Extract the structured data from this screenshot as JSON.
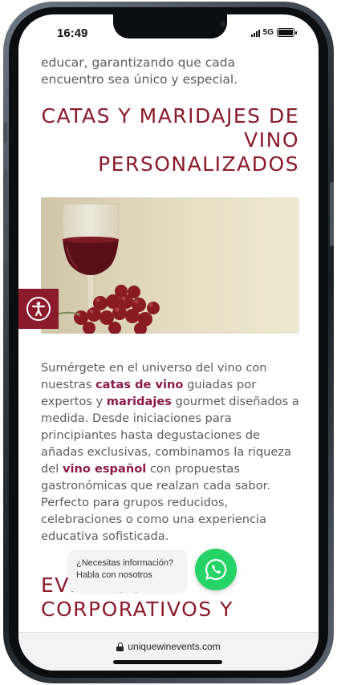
{
  "status_bar": {
    "time": "16:49",
    "network": "5G"
  },
  "article": {
    "intro_text": "educar, garantizando que cada encuentro sea único y especial.",
    "heading": "CATAS Y MARIDAJES DE VINO PERSONALIZADOS",
    "body": {
      "p1": "Sumérgete en el universo del vino con nuestras ",
      "link_catas": "catas de vino",
      "p2": " guiadas por expertos y ",
      "link_maridajes": "maridajes",
      "p3": " gourmet diseñados a medida. Desde iniciaciones para principiantes hasta degustaciones de añadas exclusivas, combinamos la riqueza del ",
      "link_vino_espanol": "vino español",
      "p4": " con propuestas gastronómicas que realzan cada sabor. Perfecto para grupos reducidos, celebraciones o como una experiencia educativa sofisticada."
    },
    "next_heading": "EVENTOS CORPORATIVOS Y"
  },
  "accessibility": {
    "icon": "accessibility-icon"
  },
  "chat": {
    "line1": "¿Necesitas información?",
    "line2": "Habla con nosotros",
    "icon": "whatsapp-icon"
  },
  "browser": {
    "url": "uniquewinevents.com"
  },
  "colors": {
    "brand": "#8b1a2b",
    "link": "#8b1a4a",
    "whatsapp": "#25d366",
    "text": "#5c5c5c"
  }
}
